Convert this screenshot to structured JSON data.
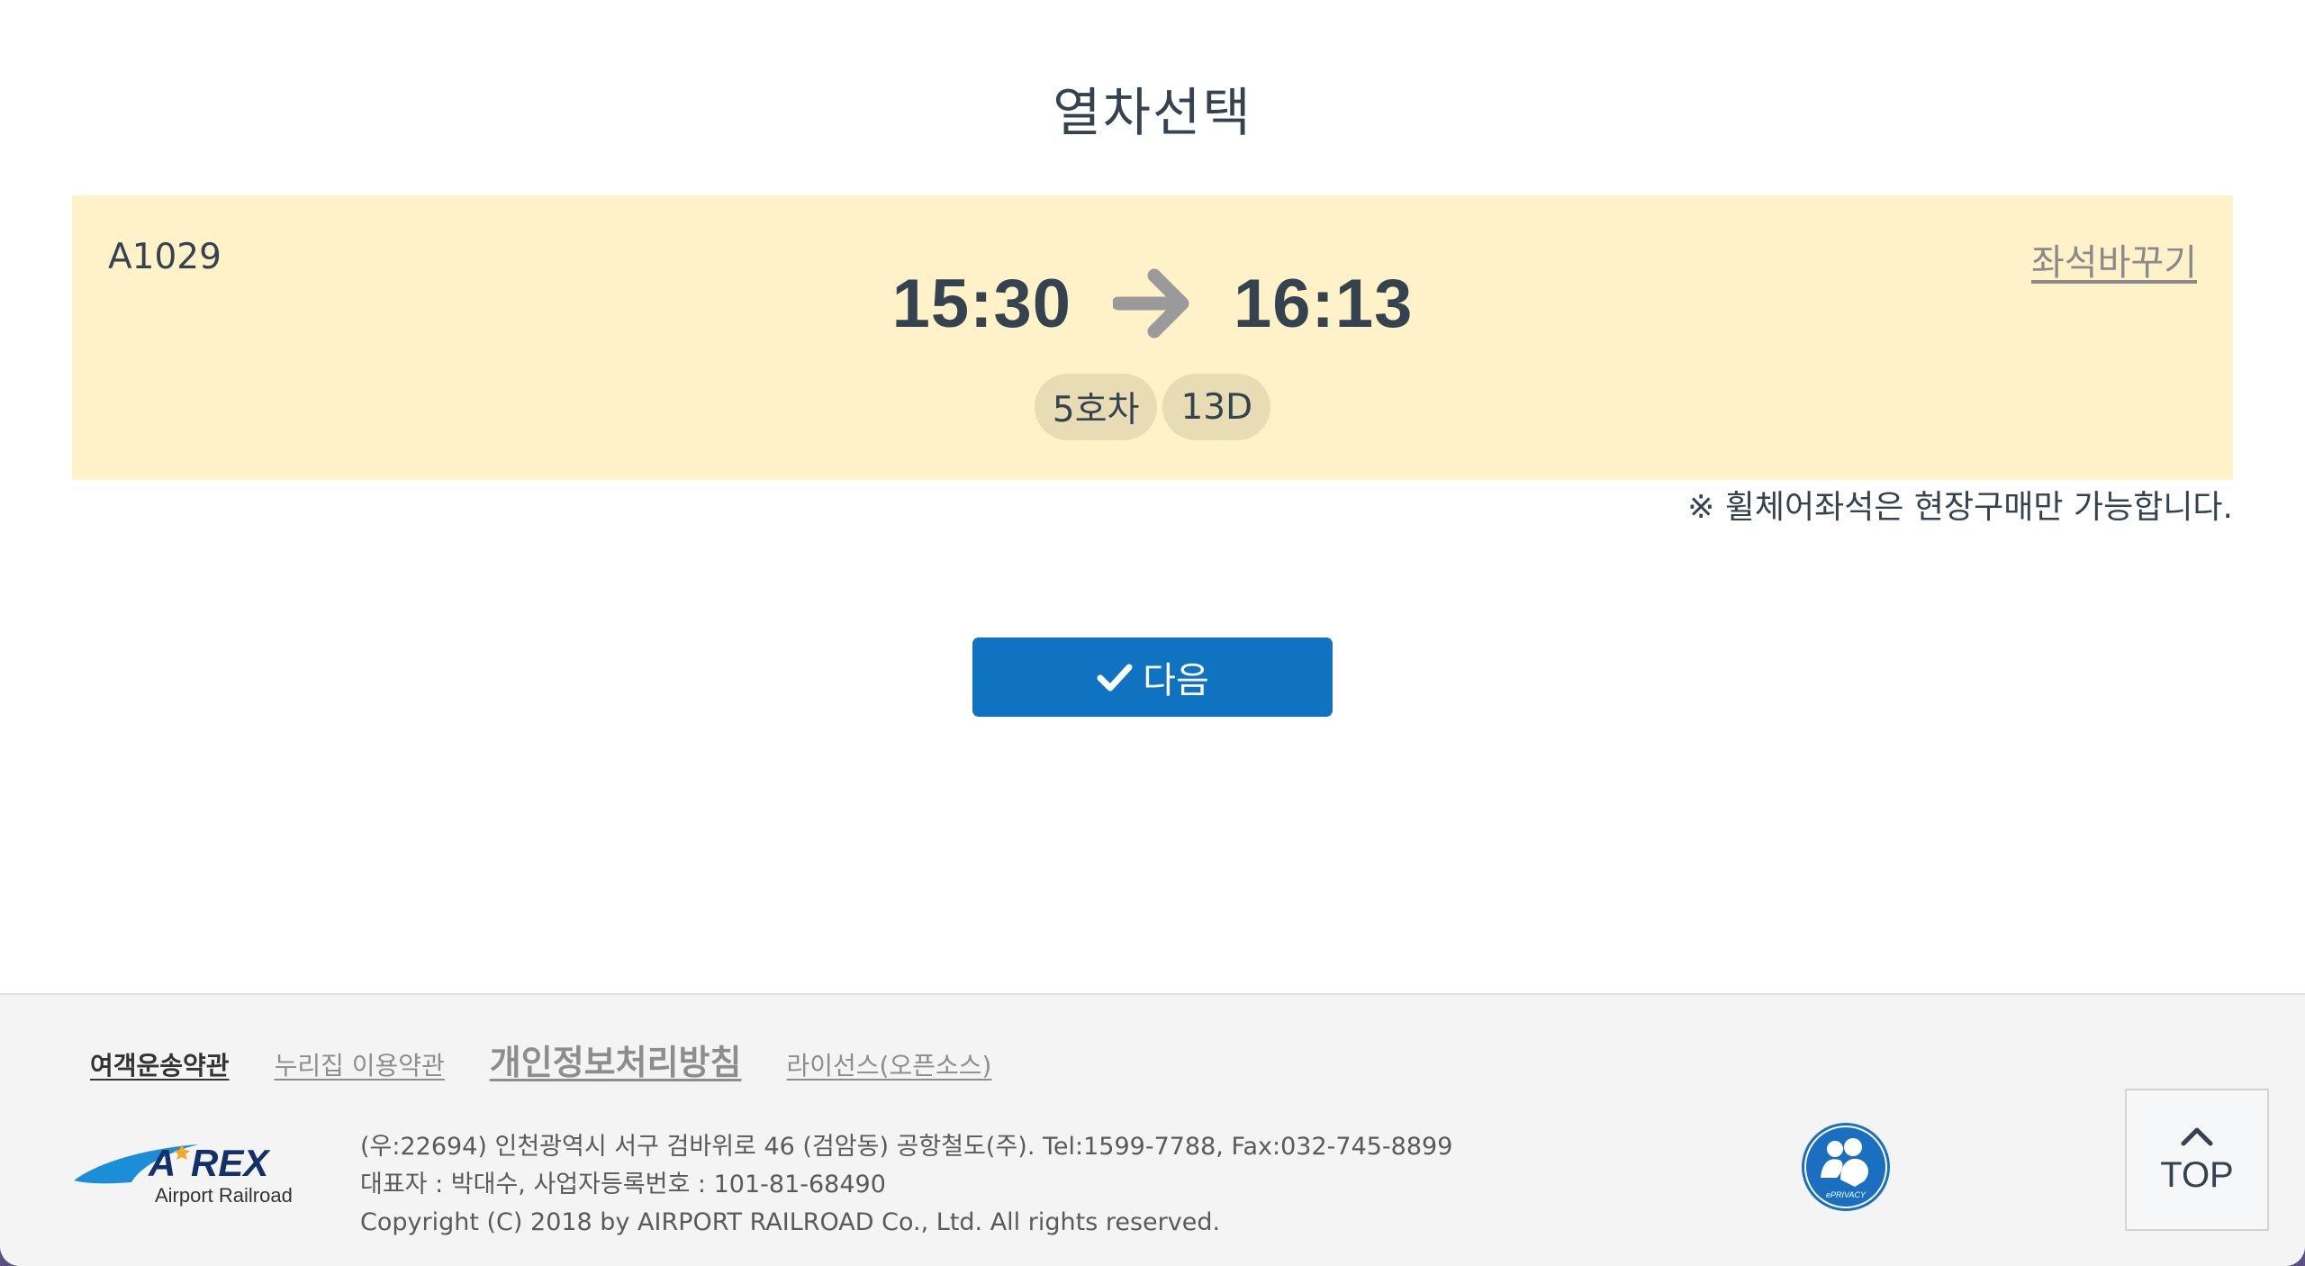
{
  "page": {
    "title": "열차선택"
  },
  "train": {
    "number": "A1029",
    "change_seat_label": "좌석바꾸기",
    "depart_time": "15:30",
    "arrive_time": "16:13",
    "car": "5호차",
    "seat": "13D"
  },
  "notice": "※ 휠체어좌석은 현장구매만 가능합니다.",
  "next_button": {
    "label": "다음"
  },
  "footer": {
    "links": [
      {
        "label": "여객운송약관"
      },
      {
        "label": "누리집 이용약관"
      },
      {
        "label": "개인정보처리방침"
      },
      {
        "label": "라이선스(오픈소스)"
      }
    ],
    "logo": {
      "text": "AREX",
      "subtext": "Airport Railroad"
    },
    "info_lines": [
      "(우:22694) 인천광역시 서구 검바위로 46 (검암동) 공항철도(주). Tel:1599-7788, Fax:032-745-8899",
      "대표자 : 박대수, 사업자등록번호 : 101-81-68490",
      "Copyright (C) 2018 by AIRPORT RAILROAD Co., Ltd. All rights reserved."
    ],
    "eprivacy_label": "ePRIVACY",
    "top_button_label": "TOP"
  },
  "colors": {
    "panel_bg": "#fff2c9",
    "badge_bg": "#e8dcb4",
    "primary": "#0f73c2",
    "text": "#34434f"
  }
}
